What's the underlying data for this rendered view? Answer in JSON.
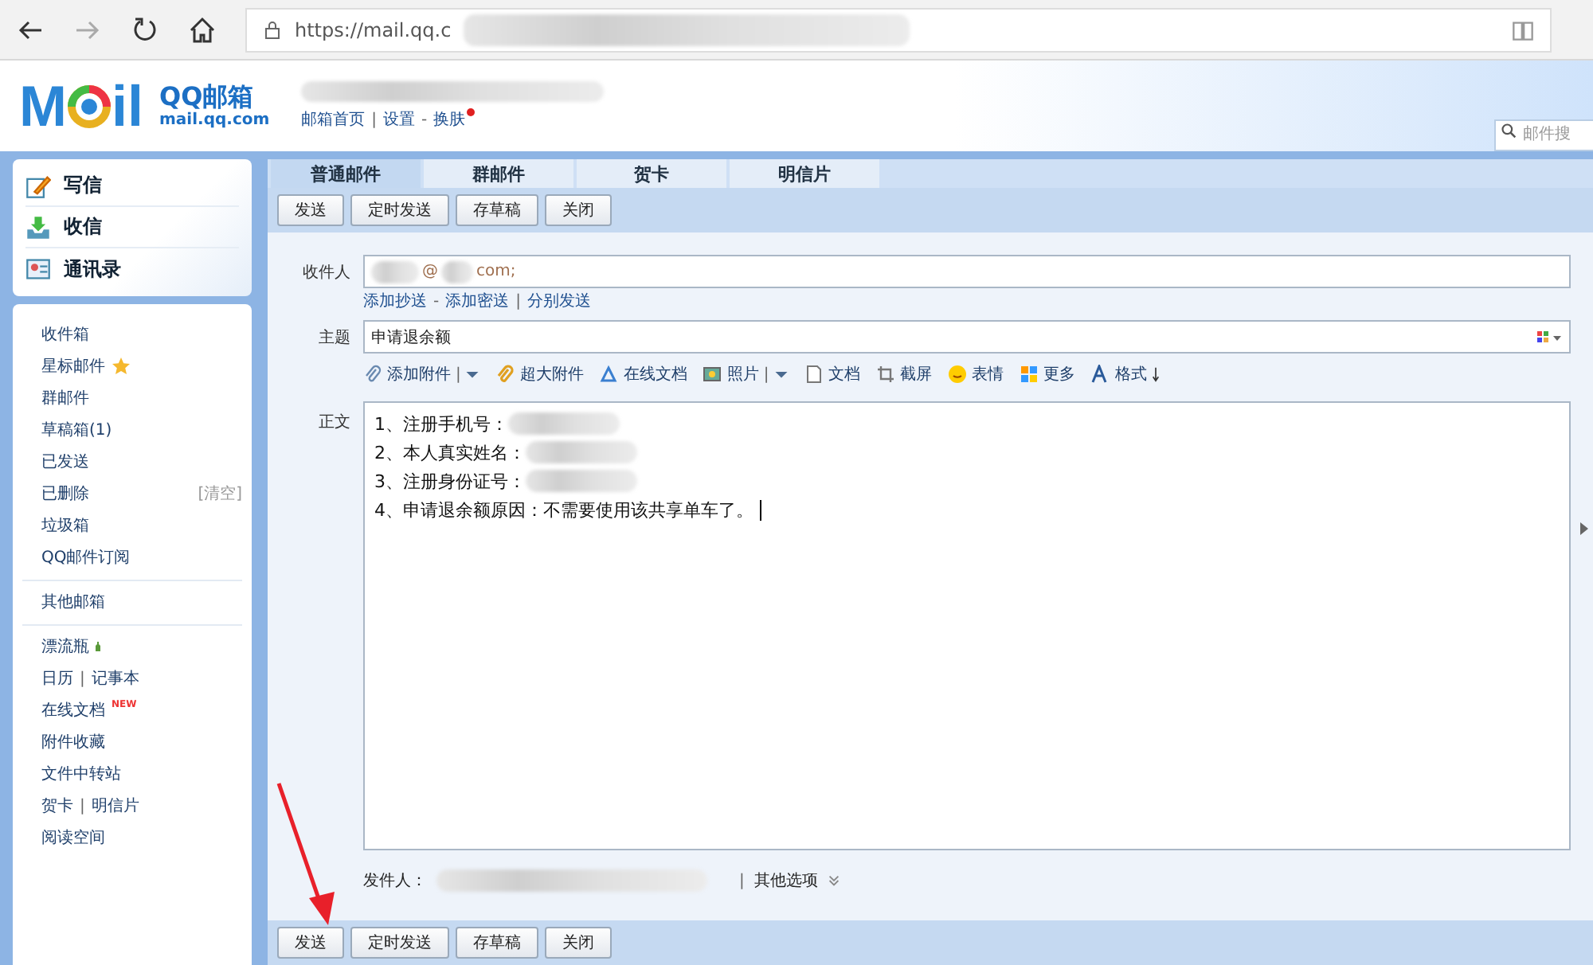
{
  "browser": {
    "url": "https://mail.qq.c"
  },
  "header": {
    "logo_left": "M",
    "logo_right": "il",
    "brand": "QQ邮箱",
    "domain": "mail.qq.com",
    "links": [
      {
        "label": "邮箱首页",
        "sep": "|"
      },
      {
        "label": "设置",
        "sep": "-"
      },
      {
        "label": "换肤",
        "dot": true
      }
    ],
    "search": {
      "placeholder": "邮件搜"
    }
  },
  "quick_actions": [
    {
      "label": "写信"
    },
    {
      "label": "收信"
    },
    {
      "label": "通讯录"
    }
  ],
  "folder_groups": [
    [
      {
        "kind": "plain",
        "label": "收件箱"
      },
      {
        "kind": "starred",
        "label": "星标邮件"
      },
      {
        "kind": "plain",
        "label": "群邮件"
      },
      {
        "kind": "plain",
        "label": "草稿箱(1)"
      },
      {
        "kind": "plain",
        "label": "已发送"
      },
      {
        "kind": "action",
        "label": "已删除",
        "action": "[清空]"
      },
      {
        "kind": "plain",
        "label": "垃圾箱"
      },
      {
        "kind": "plain",
        "label": "QQ邮件订阅"
      }
    ],
    [
      {
        "kind": "plain",
        "label": "其他邮箱"
      }
    ],
    [
      {
        "kind": "bottle",
        "label": "漂流瓶"
      },
      {
        "kind": "pair",
        "label": "日历",
        "sep": "|",
        "second": "记事本"
      },
      {
        "kind": "new",
        "label": "在线文档",
        "badge": "NEW"
      },
      {
        "kind": "plain",
        "label": "附件收藏"
      },
      {
        "kind": "plain",
        "label": "文件中转站"
      },
      {
        "kind": "pair",
        "label": "贺卡",
        "sep": "|",
        "second": "明信片"
      },
      {
        "kind": "plain",
        "label": "阅读空间"
      }
    ]
  ],
  "tabs": [
    {
      "label": "普通邮件",
      "selected": true
    },
    {
      "label": "群邮件",
      "selected": false
    },
    {
      "label": "贺卡",
      "selected": false
    },
    {
      "label": "明信片",
      "selected": false
    }
  ],
  "top_buttons": [
    "发送",
    "定时发送",
    "存草稿",
    "关闭"
  ],
  "compose": {
    "to_label": "收件人",
    "to_parts": [
      "@",
      "com;"
    ],
    "to_links": [
      {
        "label": "添加抄送",
        "sep": "-"
      },
      {
        "label": "添加密送",
        "sep": "|"
      },
      {
        "label": "分别发送"
      }
    ],
    "subject_label": "主题",
    "subject": "申请退余额",
    "tools": [
      {
        "label": "添加附件",
        "menu": true,
        "sep": "|"
      },
      {
        "label": "超大附件",
        "menu": false
      },
      {
        "label": "在线文档",
        "menu": false
      },
      {
        "label": "照片",
        "menu": true,
        "sep": "|"
      },
      {
        "label": "文档",
        "menu": false
      },
      {
        "label": "截屏",
        "menu": false
      },
      {
        "label": "表情",
        "menu": false
      },
      {
        "label": "更多",
        "menu": false
      },
      {
        "label": "格式",
        "menu": false
      }
    ],
    "body_label": "正文",
    "body_lines": [
      {
        "text": "1、注册手机号：",
        "redacted": true
      },
      {
        "text": "2、本人真实姓名：",
        "redacted": true
      },
      {
        "text": "3、注册身份证号：",
        "redacted": true
      },
      {
        "text": "4、申请退余额原因：不需要使用该共享单车了。",
        "redacted": false
      }
    ],
    "sender_label": "发件人：",
    "sender_sep": "|",
    "more_options": "其他选项"
  },
  "bottom_buttons": [
    "发送",
    "定时发送",
    "存草稿",
    "关闭"
  ]
}
